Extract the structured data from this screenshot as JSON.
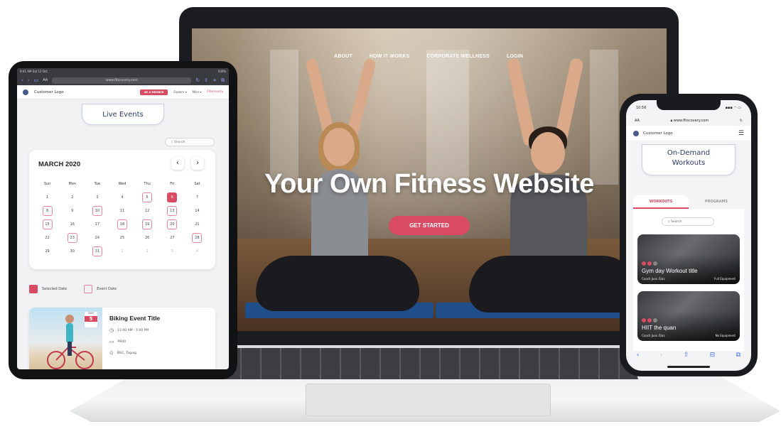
{
  "laptop": {
    "nav": [
      "ABOUT",
      "HOW IT WORKS",
      "CORPORATE WELLNESS",
      "LOGIN"
    ],
    "hero_title": "Your Own Fitness Website",
    "cta": "GET STARTED"
  },
  "tablet": {
    "statusbar_left": "9:41 AM  Sat 12 Oct",
    "statusbar_right": "100%",
    "url_aa": "AA",
    "url": "www.fitscovery.com",
    "brand": "Customer Logo",
    "member_btn": "BE A MEMBER",
    "explore": "Explore ▾",
    "user": "Mike ▾",
    "fit_brand": "Fitscovery",
    "section_title": "Live Events",
    "search_placeholder": "Search",
    "calendar": {
      "month": "MARCH 2020",
      "weekdays": [
        "Sun",
        "Mon",
        "Tue",
        "Wed",
        "Thu",
        "Fri",
        "Sat"
      ],
      "days": [
        {
          "d": "1"
        },
        {
          "d": "2"
        },
        {
          "d": "3"
        },
        {
          "d": "4"
        },
        {
          "d": "5",
          "ev": true
        },
        {
          "d": "6",
          "sel": true
        },
        {
          "d": "7"
        },
        {
          "d": "8",
          "ev": true
        },
        {
          "d": "9"
        },
        {
          "d": "10",
          "ev": true
        },
        {
          "d": "11"
        },
        {
          "d": "12"
        },
        {
          "d": "13",
          "ev": true
        },
        {
          "d": "14"
        },
        {
          "d": "15",
          "ev": true
        },
        {
          "d": "16"
        },
        {
          "d": "17"
        },
        {
          "d": "18",
          "ev": true
        },
        {
          "d": "19",
          "ev": true
        },
        {
          "d": "20",
          "ev": true
        },
        {
          "d": "21"
        },
        {
          "d": "22"
        },
        {
          "d": "23",
          "ev": true
        },
        {
          "d": "24"
        },
        {
          "d": "25"
        },
        {
          "d": "26"
        },
        {
          "d": "27"
        },
        {
          "d": "28",
          "ev": true
        },
        {
          "d": "29"
        },
        {
          "d": "30"
        },
        {
          "d": "31",
          "ev": true
        },
        {
          "d": "1",
          "muted": true
        },
        {
          "d": "2",
          "muted": true
        },
        {
          "d": "3",
          "muted": true
        },
        {
          "d": "4",
          "muted": true
        }
      ]
    },
    "legend_selected": "Selected Date",
    "legend_event": "Event Date",
    "event": {
      "badge_month": "MAR",
      "badge_day": "5",
      "title": "Biking Event Title",
      "time": "11:00 AM - 1:00 PM",
      "price": "P600",
      "location": "BGC, Taguig"
    }
  },
  "phone": {
    "time": "10:56",
    "signal": "▪▪▪ ◠ ▭",
    "url_aa": "AA",
    "url": "www.fitscovery.com",
    "brand": "Customer Logo",
    "title_line1": "On-Demand",
    "title_line2": "Workouts",
    "tabs": [
      "WORKOUTS",
      "PROGRAMS"
    ],
    "search_placeholder": "Search",
    "workouts": [
      {
        "title": "Gym day Workout title",
        "coach": "Coach Juan Diaz",
        "equip": "Full Equipment"
      },
      {
        "title": "HIIT the quan",
        "coach": "Coach Juan Diaz",
        "equip": "No Equipment"
      }
    ]
  },
  "colors": {
    "accent": "#d94a63",
    "navy": "#2b3a67",
    "ios_blue": "#3a6fe0"
  }
}
